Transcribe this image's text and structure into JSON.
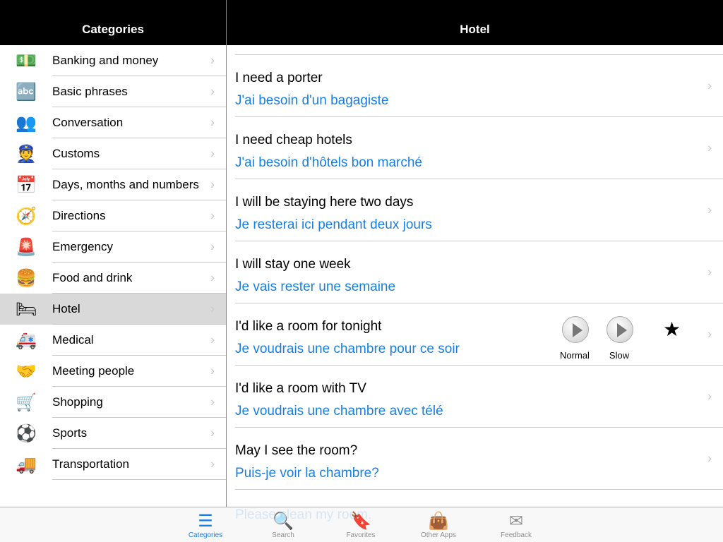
{
  "left_header": {
    "title": "Categories"
  },
  "right_header": {
    "title": "Hotel"
  },
  "categories": [
    {
      "label": "Banking and money",
      "icon": "money-icon",
      "glyph": "💵"
    },
    {
      "label": "Basic phrases",
      "icon": "abc-blocks-icon",
      "glyph": "🔤"
    },
    {
      "label": "Conversation",
      "icon": "people-icon",
      "glyph": "👥"
    },
    {
      "label": "Customs",
      "icon": "customs-officer-icon",
      "glyph": "👮"
    },
    {
      "label": "Days, months and numbers",
      "icon": "calendar-icon",
      "glyph": "📅"
    },
    {
      "label": "Directions",
      "icon": "compass-icon",
      "glyph": "🧭"
    },
    {
      "label": "Emergency",
      "icon": "siren-icon",
      "glyph": "🚨"
    },
    {
      "label": "Food and drink",
      "icon": "burger-icon",
      "glyph": "🍔"
    },
    {
      "label": "Hotel",
      "icon": "bed-icon",
      "glyph": "🛏",
      "selected": true
    },
    {
      "label": "Medical",
      "icon": "ambulance-icon",
      "glyph": "🚑"
    },
    {
      "label": "Meeting people",
      "icon": "handshake-icon",
      "glyph": "🤝"
    },
    {
      "label": "Shopping",
      "icon": "shopping-cart-icon",
      "glyph": "🛒"
    },
    {
      "label": "Sports",
      "icon": "soccer-ball-icon",
      "glyph": "⚽"
    },
    {
      "label": "Transportation",
      "icon": "truck-icon",
      "glyph": "🚚"
    }
  ],
  "phrases": [
    {
      "en": "I need a porter",
      "fr": "J'ai besoin d'un bagagiste"
    },
    {
      "en": "I need cheap hotels",
      "fr": "J'ai besoin d'hôtels bon marché"
    },
    {
      "en": "I will be staying here two days",
      "fr": "Je resterai ici pendant deux jours"
    },
    {
      "en": "I will stay one week",
      "fr": "Je vais rester une semaine"
    },
    {
      "en": "I'd like a  room for tonight",
      "fr": "Je voudrais une chambre pour ce soir",
      "expanded": true
    },
    {
      "en": "I'd like a room with TV",
      "fr": "Je voudrais une chambre avec télé"
    },
    {
      "en": "May I see the room?",
      "fr": "Puis-je voir la chambre?"
    }
  ],
  "partial_below": {
    "en": "Please clean my room."
  },
  "player": {
    "normal_label": "Normal",
    "slow_label": "Slow",
    "favorite": "★"
  },
  "tabs": [
    {
      "label": "Categories",
      "icon": "categories-icon",
      "glyph": "☰",
      "active": true
    },
    {
      "label": "Search",
      "icon": "search-icon",
      "glyph": "🔍"
    },
    {
      "label": "Favorites",
      "icon": "bookmark-icon",
      "glyph": "🔖"
    },
    {
      "label": "Other Apps",
      "icon": "shopping-bag-icon",
      "glyph": "👜"
    },
    {
      "label": "Feedback",
      "icon": "envelope-icon",
      "glyph": "✉"
    }
  ],
  "colors": {
    "accent": "#1a7fe0",
    "selected_row": "#d9d9d9",
    "header": "#000000"
  }
}
